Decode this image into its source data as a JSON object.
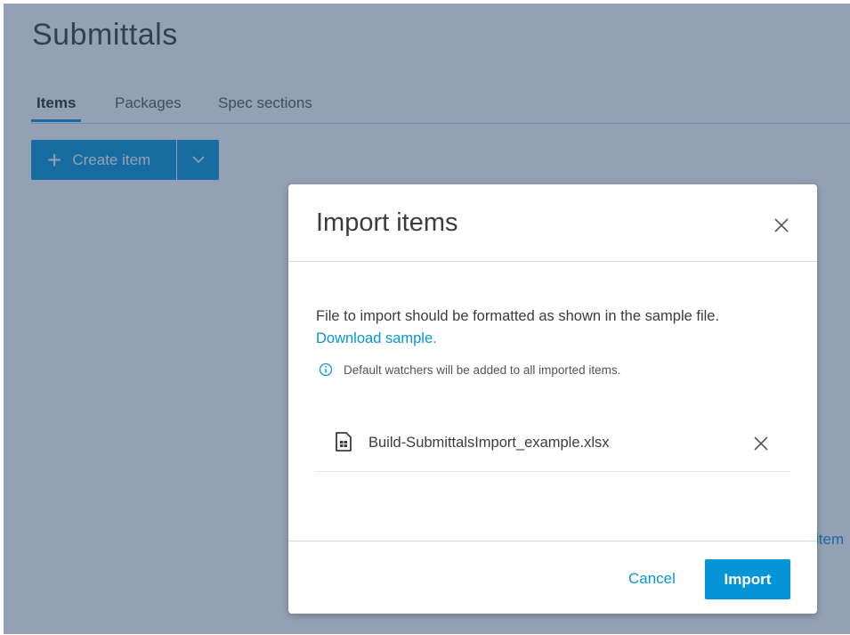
{
  "page": {
    "title": "Submittals",
    "tabs": [
      {
        "label": "Items",
        "active": true
      },
      {
        "label": "Packages",
        "active": false
      },
      {
        "label": "Spec sections",
        "active": false
      }
    ],
    "create_button_label": "Create item",
    "background_link_fragment": "item"
  },
  "modal": {
    "title": "Import items",
    "description": "File to import should be formatted as shown in the sample file.",
    "download_link": "Download sample.",
    "info_text": "Default watchers will be added to all imported items.",
    "file_name": "Build-SubmittalsImport_example.xlsx",
    "cancel_label": "Cancel",
    "import_label": "Import"
  },
  "colors": {
    "accent": "#0696d7",
    "overlay": "#27426c",
    "text": "#3c3c3c"
  },
  "icons": {
    "close": "close-icon",
    "plus": "plus-icon",
    "caret": "chevron-down-icon",
    "info": "info-icon",
    "file": "spreadsheet-file-icon"
  }
}
